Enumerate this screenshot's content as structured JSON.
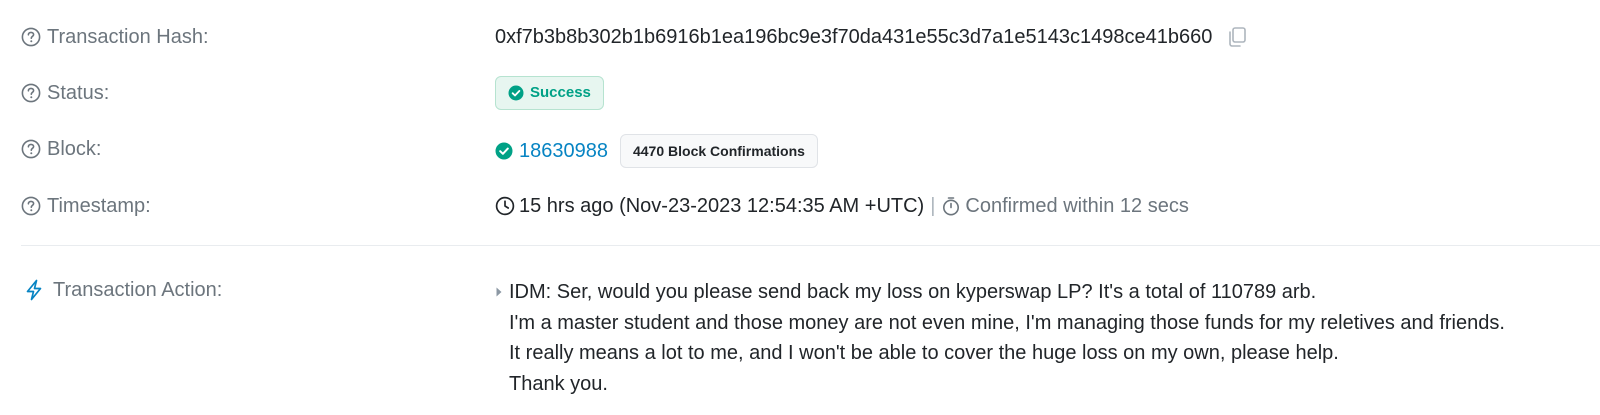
{
  "labels": {
    "transaction_hash": "Transaction Hash:",
    "status": "Status:",
    "block": "Block:",
    "timestamp": "Timestamp:",
    "transaction_action": "Transaction Action:"
  },
  "transaction": {
    "hash": "0xf7b3b8b302b1b6916b1ea196bc9e3f70da431e55c3d7a1e5143c1498ce41b660",
    "status": "Success",
    "block_number": "18630988",
    "block_confirmations": "4470 Block Confirmations",
    "timestamp_text": "15 hrs ago (Nov-23-2023 12:54:35 AM +UTC)",
    "separator": "|",
    "confirmed_text": "Confirmed within 12 secs"
  },
  "action": {
    "lines": [
      "IDM: Ser, would you please send back my loss on kyperswap LP? It's a total of 110789 arb.",
      "I'm a master student and those money are not even mine, I'm managing those funds for my reletives and friends.",
      "It really means a lot to me, and I won't be able to cover the huge loss on my own, please help.",
      "Thank you."
    ]
  },
  "colors": {
    "label": "#6c757d",
    "link": "#0784c3",
    "success": "#00a186",
    "success_bg": "#e7f6f0",
    "text": "#212529"
  },
  "icons": {
    "help": "question-circle-icon",
    "copy": "copy-icon",
    "success_check": "check-circle-icon",
    "clock": "clock-icon",
    "timer": "stopwatch-icon",
    "bolt": "lightning-bolt-icon",
    "caret": "caret-right-icon"
  }
}
